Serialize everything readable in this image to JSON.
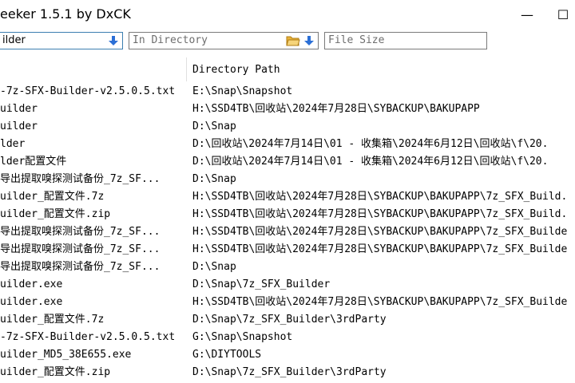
{
  "window": {
    "title": "eeker 1.5.1 by DxCK",
    "minimize_label": "—",
    "maximize_label": "☐"
  },
  "toolbar": {
    "search_value": "ilder",
    "directory_placeholder": "In Directory",
    "size_placeholder": "File Size"
  },
  "columns": {
    "directory_path": "Directory Path"
  },
  "rows": [
    {
      "name": "-7z-SFX-Builder-v2.5.0.5.txt",
      "dir": "E:\\Snap\\Snapshot"
    },
    {
      "name": "uilder",
      "dir": "H:\\SSD4TB\\回收站\\2024年7月28日\\SYBACKUP\\BAKUPAPP"
    },
    {
      "name": "uilder",
      "dir": "D:\\Snap"
    },
    {
      "name": "lder",
      "dir": "D:\\回收站\\2024年7月14日\\01 - 收集箱\\2024年6月12日\\回收站\\f\\20."
    },
    {
      "name": "lder配置文件",
      "dir": "D:\\回收站\\2024年7月14日\\01 - 收集箱\\2024年6月12日\\回收站\\f\\20."
    },
    {
      "name": "导出提取嗅探测试备份_7z_SF...",
      "dir": "D:\\Snap"
    },
    {
      "name": "uilder_配置文件.7z",
      "dir": "H:\\SSD4TB\\回收站\\2024年7月28日\\SYBACKUP\\BAKUPAPP\\7z_SFX_Build."
    },
    {
      "name": "uilder_配置文件.zip",
      "dir": "H:\\SSD4TB\\回收站\\2024年7月28日\\SYBACKUP\\BAKUPAPP\\7z_SFX_Build."
    },
    {
      "name": "导出提取嗅探测试备份_7z_SF...",
      "dir": "H:\\SSD4TB\\回收站\\2024年7月28日\\SYBACKUP\\BAKUPAPP\\7z_SFX_Builde"
    },
    {
      "name": "导出提取嗅探测试备份_7z_SF...",
      "dir": "H:\\SSD4TB\\回收站\\2024年7月28日\\SYBACKUP\\BAKUPAPP\\7z_SFX_Builde"
    },
    {
      "name": "导出提取嗅探测试备份_7z_SF...",
      "dir": "D:\\Snap"
    },
    {
      "name": "uilder.exe",
      "dir": "D:\\Snap\\7z_SFX_Builder"
    },
    {
      "name": "uilder.exe",
      "dir": "H:\\SSD4TB\\回收站\\2024年7月28日\\SYBACKUP\\BAKUPAPP\\7z_SFX_Builde"
    },
    {
      "name": "uilder_配置文件.7z",
      "dir": "D:\\Snap\\7z_SFX_Builder\\3rdParty"
    },
    {
      "name": "-7z-SFX-Builder-v2.5.0.5.txt",
      "dir": "G:\\Snap\\Snapshot"
    },
    {
      "name": "uilder_MD5_38E655.exe",
      "dir": "G:\\DIYTOOLS"
    },
    {
      "name": "uilder_配置文件.zip",
      "dir": "D:\\Snap\\7z_SFX_Builder\\3rdParty"
    }
  ],
  "colors": {
    "focus_border": "#3c7fb1",
    "arrow_blue": "#2b6fd6",
    "folder_yellow": "#f2c14e"
  }
}
